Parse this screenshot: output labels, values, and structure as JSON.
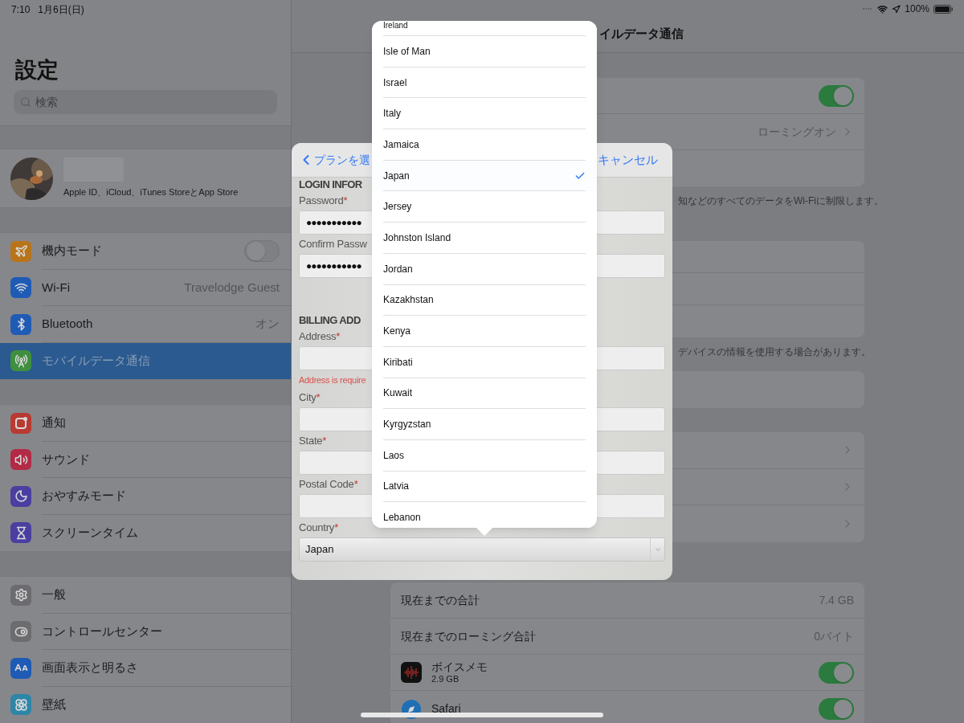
{
  "status_bar": {
    "time": "7:10",
    "date": "1月6日(日)",
    "battery": "100%"
  },
  "sidebar": {
    "title": "設定",
    "search": {
      "placeholder": "検索"
    },
    "profile": {
      "subtitle": "Apple ID、iCloud、iTunes StoreとApp Store"
    },
    "groups": [
      [
        {
          "label": "機内モード",
          "kind": "toggle",
          "on": false,
          "selected": false
        },
        {
          "label": "Wi-Fi",
          "kind": "value",
          "value": "Travelodge Guest",
          "selected": false
        },
        {
          "label": "Bluetooth",
          "kind": "value",
          "value": "オン",
          "selected": false
        },
        {
          "label": "モバイルデータ通信",
          "kind": "plain",
          "selected": true
        }
      ],
      [
        {
          "label": "通知",
          "kind": "plain",
          "selected": false
        },
        {
          "label": "サウンド",
          "kind": "plain",
          "selected": false
        },
        {
          "label": "おやすみモード",
          "kind": "plain",
          "selected": false
        },
        {
          "label": "スクリーンタイム",
          "kind": "plain",
          "selected": false
        }
      ],
      [
        {
          "label": "一般",
          "kind": "plain",
          "selected": false
        },
        {
          "label": "コントロールセンター",
          "kind": "plain",
          "selected": false
        },
        {
          "label": "画面表示と明るさ",
          "kind": "plain",
          "selected": false
        },
        {
          "label": "壁紙",
          "kind": "plain",
          "selected": false
        }
      ]
    ]
  },
  "detail": {
    "title": "イルデータ通信",
    "groups": [
      {
        "rows": [
          {
            "kind": "toggle",
            "on": true
          },
          {
            "kind": "value",
            "value": "ローミングオン"
          },
          {
            "kind": "blank"
          }
        ],
        "footer": "知などのすべてのデータをWi-Fiに制限します。"
      },
      {
        "rows": [
          {
            "kind": "blank"
          },
          {
            "kind": "blank"
          },
          {
            "kind": "blank"
          }
        ],
        "footer": "デバイスの情報を使用する場合があります。"
      },
      {
        "rows": [
          {
            "kind": "blank"
          }
        ]
      },
      {
        "rows": [
          {
            "kind": "chevron"
          },
          {
            "kind": "chevron"
          },
          {
            "kind": "chevron"
          }
        ]
      },
      {
        "rows": [
          {
            "kind": "value",
            "label": "現在までの合計",
            "value": "7.4 GB"
          },
          {
            "kind": "value",
            "label": "現在までのローミング合計",
            "value": "0バイト"
          },
          {
            "kind": "app",
            "label": "ボイスメモ",
            "subtitle": "2.9 GB",
            "on": true
          },
          {
            "kind": "app",
            "label": "Safari",
            "on": true
          }
        ]
      }
    ]
  },
  "modal": {
    "back": "プランを選",
    "cancel": "キャンセル",
    "sections": [
      {
        "heading": "LOGIN INFOR",
        "fields": [
          {
            "label": "Password",
            "required_mark": "*",
            "kind": "password",
            "value": "●●●●●●●●●●●"
          },
          {
            "label": "Confirm Passw",
            "kind": "password",
            "value": "●●●●●●●●●●●"
          }
        ]
      },
      {
        "heading": "BILLING ADD",
        "fields": [
          {
            "label": "Address",
            "required_mark": "*",
            "kind": "text",
            "error": "Address is require"
          },
          {
            "label": "City",
            "required_mark": "*",
            "kind": "text"
          },
          {
            "label": "State",
            "required_mark": "*",
            "kind": "text"
          },
          {
            "label": "Postal Code",
            "required_mark": "*",
            "kind": "text"
          },
          {
            "label": "Country",
            "required_mark": "*",
            "kind": "select",
            "value": "Japan"
          }
        ]
      }
    ]
  },
  "picker": {
    "items": [
      {
        "label": "Ireland",
        "selected": false
      },
      {
        "label": "Isle of Man",
        "selected": false
      },
      {
        "label": "Israel",
        "selected": false
      },
      {
        "label": "Italy",
        "selected": false
      },
      {
        "label": "Jamaica",
        "selected": false
      },
      {
        "label": "Japan",
        "selected": true
      },
      {
        "label": "Jersey",
        "selected": false
      },
      {
        "label": "Johnston Island",
        "selected": false
      },
      {
        "label": "Jordan",
        "selected": false
      },
      {
        "label": "Kazakhstan",
        "selected": false
      },
      {
        "label": "Kenya",
        "selected": false
      },
      {
        "label": "Kiribati",
        "selected": false
      },
      {
        "label": "Kuwait",
        "selected": false
      },
      {
        "label": "Kyrgyzstan",
        "selected": false
      },
      {
        "label": "Laos",
        "selected": false
      },
      {
        "label": "Latvia",
        "selected": false
      },
      {
        "label": "Lebanon",
        "selected": false
      }
    ]
  }
}
